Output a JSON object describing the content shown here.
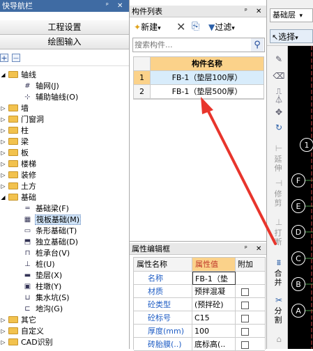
{
  "nav": {
    "title": "快导航栏",
    "pin": "ᵖ",
    "close": "✕",
    "btn1": "工程设置",
    "btn2": "绘图输入",
    "toolbar": {
      "add": "+",
      "remove": "—"
    },
    "tree": [
      {
        "label": "轴线",
        "expanded": true,
        "type": "folder"
      },
      {
        "label": "轴网(J)",
        "type": "child",
        "icon": "grid-icon"
      },
      {
        "label": "辅助轴线(O)",
        "type": "child",
        "icon": "aux-axis-icon"
      },
      {
        "label": "墙",
        "type": "folder"
      },
      {
        "label": "门窗洞",
        "type": "folder"
      },
      {
        "label": "柱",
        "type": "folder"
      },
      {
        "label": "梁",
        "type": "folder"
      },
      {
        "label": "板",
        "type": "folder"
      },
      {
        "label": "楼梯",
        "type": "folder"
      },
      {
        "label": "装修",
        "type": "folder"
      },
      {
        "label": "土方",
        "type": "folder"
      },
      {
        "label": "基础",
        "expanded": true,
        "type": "folder"
      },
      {
        "label": "基础梁(F)",
        "type": "child",
        "icon": "beam-icon"
      },
      {
        "label": "筏板基础(M)",
        "type": "child",
        "icon": "raft-icon",
        "selected": true
      },
      {
        "label": "条形基础(T)",
        "type": "child",
        "icon": "strip-icon"
      },
      {
        "label": "独立基础(D)",
        "type": "child",
        "icon": "isolated-icon"
      },
      {
        "label": "桩承台(V)",
        "type": "child",
        "icon": "pilecap-icon"
      },
      {
        "label": "桩(U)",
        "type": "child",
        "icon": "pile-icon"
      },
      {
        "label": "垫层(X)",
        "type": "child",
        "icon": "cushion-icon"
      },
      {
        "label": "柱墩(Y)",
        "type": "child",
        "icon": "pier-icon"
      },
      {
        "label": "集水坑(S)",
        "type": "child",
        "icon": "sump-icon"
      },
      {
        "label": "地沟(G)",
        "type": "child",
        "icon": "trench-icon"
      },
      {
        "label": "其它",
        "type": "folder"
      },
      {
        "label": "自定义",
        "type": "folder"
      },
      {
        "label": "CAD识别",
        "type": "folder"
      }
    ]
  },
  "components": {
    "title": "构件列表",
    "pin": "ᵖ",
    "close": "✕",
    "toolbar": {
      "new": "新建",
      "new_arrow": "▾",
      "delete": "✕",
      "copy": "⎘",
      "filter": "过滤",
      "filter_arrow": "▾"
    },
    "search_placeholder": "搜索构件...",
    "header": "构件名称",
    "rows": [
      {
        "num": "1",
        "name": "FB-1（垫层100厚）",
        "selected": true
      },
      {
        "num": "2",
        "name": "FB-1（垫层500厚）",
        "selected": false
      }
    ]
  },
  "props": {
    "title": "属性编辑框",
    "pin": "ᵖ",
    "close": "✕",
    "headers": [
      "属性名称",
      "属性值",
      "附加"
    ],
    "rows": [
      {
        "name": "名称",
        "value": "FB-1（垫",
        "checkbox": false
      },
      {
        "name": "材质",
        "value": "预拌混凝",
        "checkbox": true
      },
      {
        "name": "砼类型",
        "value": "(预拌砼)",
        "checkbox": true
      },
      {
        "name": "砼标号",
        "value": "C15",
        "checkbox": true
      },
      {
        "name": "厚度(mm)",
        "value": "100",
        "checkbox": true
      },
      {
        "name": "砖胎膜(..)",
        "value": "底标高(..",
        "checkbox": true
      }
    ]
  },
  "right_toolbar": {
    "layer": "基础层",
    "layer_arrow": "▾",
    "select": "选择",
    "select_arrow": "▾",
    "tools": [
      "延伸",
      "修剪",
      "打断",
      "合并",
      "分割"
    ]
  },
  "canvas": {
    "axis_labels": [
      "1",
      "F",
      "E",
      "D",
      "C",
      "B",
      "A"
    ]
  },
  "colors": {
    "annotation_arrow": "#e8352c",
    "selected_row": "#d8ecfb",
    "header_orange": "#fbd28a",
    "tree_selected": "#cfe3f7"
  }
}
